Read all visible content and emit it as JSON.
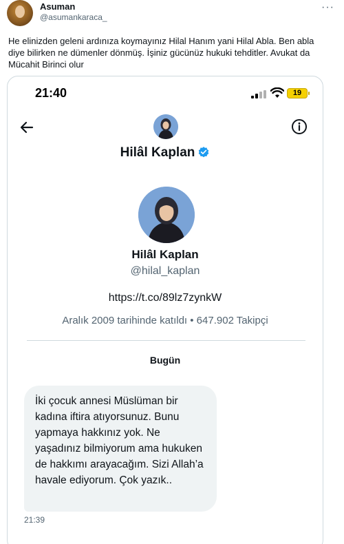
{
  "tweet": {
    "author_name": "Asuman",
    "author_handle": "@asumankaraca_",
    "text": "He elinizden geleni ardınıza koymayınız Hilal Hanım yani Hilal Abla. Ben abla diye bilirken ne dümenler dönmüş. İşiniz gücünüz hukuki tehditler. Avukat da Mücahit Birinci olur",
    "more_icon": "more-horizontal-icon"
  },
  "screenshot": {
    "status_bar": {
      "time": "21:40",
      "battery": "19",
      "battery_color": "#f5d000"
    },
    "header": {
      "name": "Hilâl Kaplan",
      "verified_color": "#1d9bf0"
    },
    "profile": {
      "name": "Hilâl Kaplan",
      "handle": "@hilal_kaplan",
      "link": "https://t.co/89lz7zynkW",
      "meta": "Aralık 2009 tarihinde katıldı • 647.902 Takipçi"
    },
    "conversation": {
      "day_label": "Bugün",
      "message": "İki çocuk annesi Müslüman bir kadına iftira atıyorsunuz. Bunu yapmaya hakkınız yok. Ne yaşadınız bilmiyorum ama hukuken de hakkımı arayacağım. Sizi Allah’a havale ediyorum. Çok yazık..",
      "time": "21:39"
    }
  }
}
